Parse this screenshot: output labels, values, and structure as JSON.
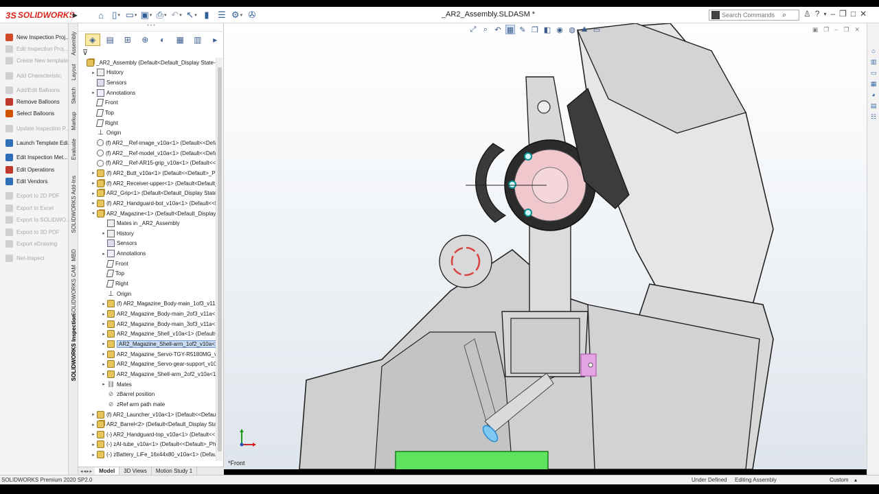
{
  "app": {
    "logo_prefix": "3S",
    "logo_text": "SOLIDWORKS",
    "document_title": "_AR2_Assembly.SLDASM *"
  },
  "search": {
    "placeholder": "Search Commands"
  },
  "commands": [
    {
      "label": "New Inspection Proj...",
      "enabled": true,
      "color": "#d24a2a"
    },
    {
      "label": "Edit Inspection Proj...",
      "enabled": false,
      "color": "#cfcfcf"
    },
    {
      "label": "Create New template",
      "enabled": false,
      "color": "#cfcfcf"
    },
    {
      "label": "Add Characteristic",
      "enabled": false,
      "color": "#cfcfcf"
    },
    {
      "label": "Add/Edit Balloons",
      "enabled": false,
      "color": "#cfcfcf"
    },
    {
      "label": "Remove Balloons",
      "enabled": true,
      "color": "#c0392b"
    },
    {
      "label": "Select Balloons",
      "enabled": true,
      "color": "#d35400"
    },
    {
      "label": "Update Inspection P...",
      "enabled": false,
      "color": "#cfcfcf"
    },
    {
      "label": "Launch Template Edi...",
      "enabled": true,
      "color": "#2e6fb7"
    },
    {
      "label": "Edit Inspection Met...",
      "enabled": true,
      "color": "#2e6fb7"
    },
    {
      "label": "Edit Operations",
      "enabled": true,
      "color": "#c0392b"
    },
    {
      "label": "Edit Vendors",
      "enabled": true,
      "color": "#2e6fb7"
    },
    {
      "label": "Export to 2D PDF",
      "enabled": false,
      "color": "#cfcfcf"
    },
    {
      "label": "Export to Excel",
      "enabled": false,
      "color": "#cfcfcf"
    },
    {
      "label": "Export to SOLIDWO...",
      "enabled": false,
      "color": "#cfcfcf"
    },
    {
      "label": "Export to 3D PDF",
      "enabled": false,
      "color": "#cfcfcf"
    },
    {
      "label": "Export eDrawing",
      "enabled": false,
      "color": "#cfcfcf"
    },
    {
      "label": "Net-Inspect",
      "enabled": false,
      "color": "#cfcfcf"
    }
  ],
  "vertical_tabs": [
    {
      "label": "Assembly",
      "active": false
    },
    {
      "label": "Layout",
      "active": false
    },
    {
      "label": "Sketch",
      "active": false
    },
    {
      "label": "Markup",
      "active": false
    },
    {
      "label": "Evaluate",
      "active": false
    },
    {
      "label": "SOLIDWORKS Add-Ins",
      "active": false
    },
    {
      "label": "MBD",
      "active": false
    },
    {
      "label": "SOLIDWORKS CAM",
      "active": false
    },
    {
      "label": "SOLIDWORKS Inspection",
      "active": true
    }
  ],
  "tree": [
    {
      "text": "_AR2_Assembly  (Default<Default_Display State-1>)",
      "icon": "asm",
      "level": 0,
      "toggle": ""
    },
    {
      "text": "History",
      "icon": "folder",
      "level": 1,
      "toggle": "▸"
    },
    {
      "text": "Sensors",
      "icon": "sens",
      "level": 1,
      "toggle": ""
    },
    {
      "text": "Annotations",
      "icon": "ann",
      "level": 1,
      "toggle": "▸"
    },
    {
      "text": "Front",
      "icon": "plane",
      "level": 1,
      "toggle": ""
    },
    {
      "text": "Top",
      "icon": "plane",
      "level": 1,
      "toggle": ""
    },
    {
      "text": "Right",
      "icon": "plane",
      "level": 1,
      "toggle": ""
    },
    {
      "text": "Origin",
      "icon": "origin",
      "level": 1,
      "toggle": ""
    },
    {
      "text": "(f) AR2__Ref-image_v10a<1> (Default<<Default",
      "icon": "ref",
      "level": 1,
      "toggle": ""
    },
    {
      "text": "(f) AR2__Ref-model_v10a<1> (Default<<Defau",
      "icon": "ref",
      "level": 1,
      "toggle": ""
    },
    {
      "text": "(f) AR2__Ref-AR15-grip_v10a<1> (Default<<De",
      "icon": "ref",
      "level": 1,
      "toggle": ""
    },
    {
      "text": "(f) AR2_Butt_v10a<1> (Default<<Default>_Pho",
      "icon": "part",
      "level": 1,
      "toggle": "▸"
    },
    {
      "text": "(f) AR2_Receiver-upper<1> (Default<Default_D",
      "icon": "asm",
      "level": 1,
      "toggle": "▸"
    },
    {
      "text": "AR2_Grip<1> (Default<Default_Display State-1",
      "icon": "asm",
      "level": 1,
      "toggle": "▸"
    },
    {
      "text": "(f) AR2_Handguard-bot_v10a<1> (Default<<De",
      "icon": "part",
      "level": 1,
      "toggle": "▸"
    },
    {
      "text": "AR2_Magazine<1> (Default<Default_Display St",
      "icon": "asm",
      "level": 1,
      "toggle": "▾"
    },
    {
      "text": "Mates in _AR2_Assembly",
      "icon": "folder",
      "level": 2,
      "toggle": ""
    },
    {
      "text": "History",
      "icon": "folder",
      "level": 2,
      "toggle": "▸"
    },
    {
      "text": "Sensors",
      "icon": "sens",
      "level": 2,
      "toggle": ""
    },
    {
      "text": "Annotations",
      "icon": "ann",
      "level": 2,
      "toggle": "▸"
    },
    {
      "text": "Front",
      "icon": "plane",
      "level": 2,
      "toggle": ""
    },
    {
      "text": "Top",
      "icon": "plane",
      "level": 2,
      "toggle": ""
    },
    {
      "text": "Right",
      "icon": "plane",
      "level": 2,
      "toggle": ""
    },
    {
      "text": "Origin",
      "icon": "origin",
      "level": 2,
      "toggle": ""
    },
    {
      "text": "(f) AR2_Magazine_Body-main_1of3_v11a<",
      "icon": "part",
      "level": 2,
      "toggle": "▸"
    },
    {
      "text": "AR2_Magazine_Body-main_2of3_v11a<1>",
      "icon": "part",
      "level": 2,
      "toggle": "▸"
    },
    {
      "text": "AR2_Magazine_Body-main_3of3_v11a<1>",
      "icon": "part",
      "level": 2,
      "toggle": "▸"
    },
    {
      "text": "AR2_Magazine_Shell_v10a<1> (Default<<",
      "icon": "part",
      "level": 2,
      "toggle": "▸"
    },
    {
      "text": "AR2_Magazine_Shell-arm_1of2_v10a<1> (I",
      "icon": "part",
      "level": 2,
      "toggle": "▸",
      "selected": true
    },
    {
      "text": "AR2_Magazine_Servo-TGY-R5180MG_v10a",
      "icon": "part",
      "level": 2,
      "toggle": "▸"
    },
    {
      "text": "AR2_Magazine_Servo-gear-support_v10a<",
      "icon": "part",
      "level": 2,
      "toggle": "▸"
    },
    {
      "text": "AR2_Magazine_Shell-arm_2of2_v10a<1> (I",
      "icon": "part",
      "level": 2,
      "toggle": "▸"
    },
    {
      "text": "Mates",
      "icon": "mates",
      "level": 2,
      "toggle": "▸"
    },
    {
      "text": "zBarrel position",
      "icon": "mate",
      "level": 2,
      "toggle": ""
    },
    {
      "text": "zRef arm path mate",
      "icon": "mate",
      "level": 2,
      "toggle": ""
    },
    {
      "text": "(f) AR2_Launcher_v10a<1> (Default<<Default>",
      "icon": "part",
      "level": 1,
      "toggle": "▸"
    },
    {
      "text": "AR2_Barrel<2> (Default<Default_Display State-",
      "icon": "asm",
      "level": 1,
      "toggle": "▸"
    },
    {
      "text": "(-) AR2_Handguard-top_v10a<1> (Default<<D",
      "icon": "part",
      "level": 1,
      "toggle": "▸"
    },
    {
      "text": "(-) zAI-tube_v10a<1> (Default<<Default>_Pho",
      "icon": "part",
      "level": 1,
      "toggle": "▸"
    },
    {
      "text": "(-) zBattery_LiFe_16x44x80_v10a<1> (Default<<",
      "icon": "part",
      "level": 1,
      "toggle": "▸"
    }
  ],
  "bottom_tabs": [
    {
      "label": "Model",
      "active": true
    },
    {
      "label": "3D Views",
      "active": false
    },
    {
      "label": "Motion Study 1",
      "active": false
    }
  ],
  "viewport": {
    "view_name": "*Front"
  },
  "status": {
    "version": "SOLIDWORKS Premium 2020 SP2.0",
    "definition": "Under Defined",
    "mode": "Editing Assembly",
    "units": "Custom"
  }
}
